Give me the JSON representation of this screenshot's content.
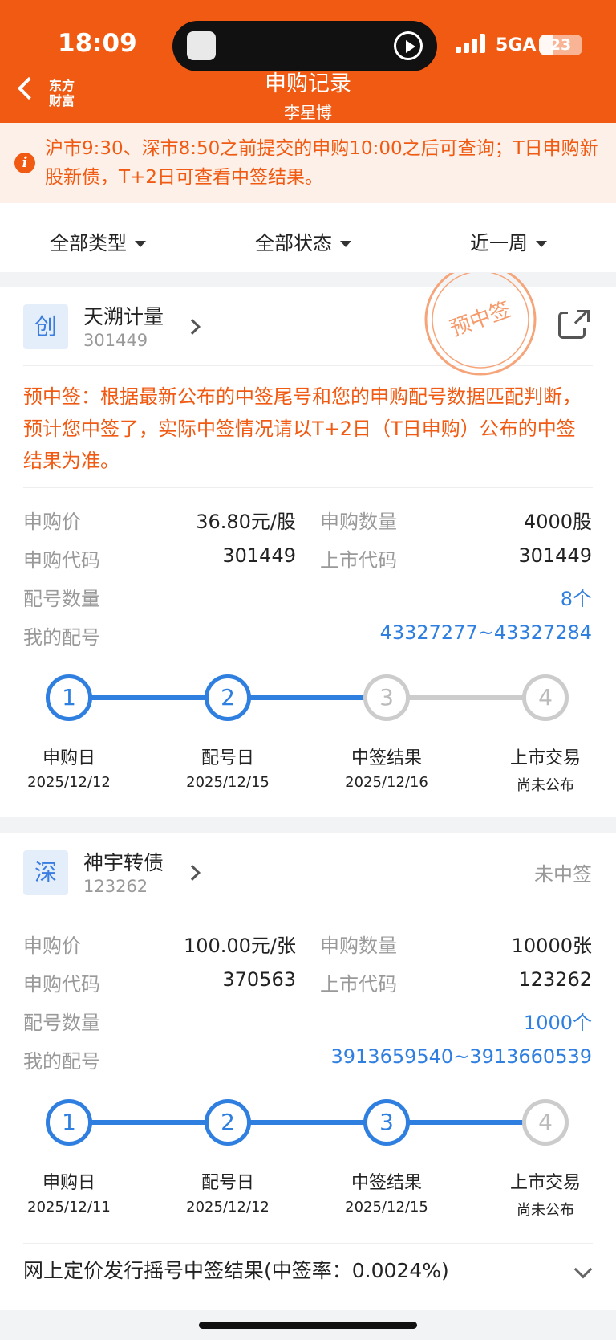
{
  "status_bar": {
    "time": "18:09",
    "network": "5GA",
    "battery": "23"
  },
  "header": {
    "logo_line1": "东方",
    "logo_line2": "财富",
    "title": "申购记录",
    "subtitle": "李星博"
  },
  "notice": {
    "text": "沪市9:30、深市8:50之前提交的申购10:00之后可查询；T日申购新股新债，T+2日可查看中签结果。"
  },
  "filters": {
    "type": "全部类型",
    "status": "全部状态",
    "period": "近一周"
  },
  "labels": {
    "price": "申购价",
    "quantity": "申购数量",
    "sub_code": "申购代码",
    "list_code": "上市代码",
    "alloc_count": "配号数量",
    "my_alloc": "我的配号"
  },
  "steps": {
    "s1": "申购日",
    "s2": "配号日",
    "s3": "中签结果",
    "s4": "上市交易"
  },
  "cards": [
    {
      "board": "创",
      "name": "天溯计量",
      "code": "301449",
      "stamp": "预中签",
      "message": "预中签：根据最新公布的中签尾号和您的申购配号数据匹配判断，预计您中签了，实际中签情况请以T+2日（T日申购）公布的中签结果为准。",
      "price": "36.80元/股",
      "quantity": "4000股",
      "sub_code": "301449",
      "list_code": "301449",
      "alloc_count": "8个",
      "my_alloc": "43327277~43327284",
      "dates": [
        "2025/12/12",
        "2025/12/15",
        "2025/12/16",
        "尚未公布"
      ],
      "completed_steps": 2
    },
    {
      "board": "深",
      "name": "神宇转债",
      "code": "123262",
      "status": "未中签",
      "price": "100.00元/张",
      "quantity": "10000张",
      "sub_code": "370563",
      "list_code": "123262",
      "alloc_count": "1000个",
      "my_alloc": "3913659540~3913660539",
      "dates": [
        "2025/12/11",
        "2025/12/12",
        "2025/12/15",
        "尚未公布"
      ],
      "completed_steps": 3,
      "result_summary": "网上定价发行摇号中签结果(中签率：0.0024%)"
    }
  ],
  "colors": {
    "brand": "#f05a12",
    "accent": "#2f7fe0",
    "muted": "#999999"
  }
}
